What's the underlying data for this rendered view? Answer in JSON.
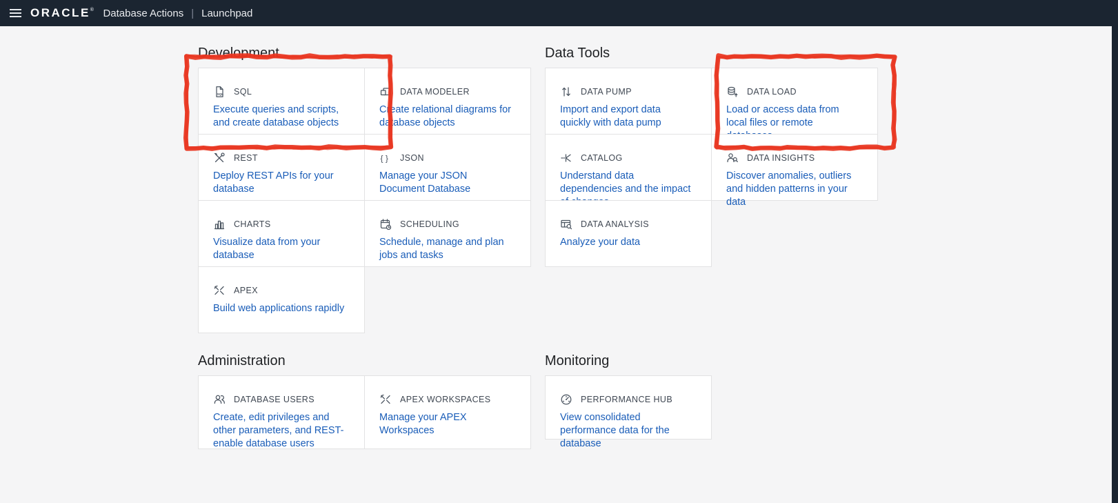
{
  "header": {
    "brand": "ORACLE",
    "brand_mark": "®",
    "app_title": "Database Actions",
    "separator": "|",
    "page_title": "Launchpad"
  },
  "colors": {
    "header_bg": "#1b2531",
    "page_bg": "#f5f5f6",
    "link_blue": "#1a5db8",
    "annotation_red": "#e8351f"
  },
  "sections": [
    {
      "title": "Development",
      "columns": [
        {
          "cards": [
            {
              "icon": "sql-file",
              "label": "SQL",
              "description": "Execute queries and scripts, and create database objects"
            },
            {
              "icon": "rest-tools",
              "label": "REST",
              "description": "Deploy REST APIs for your database"
            },
            {
              "icon": "bar-chart",
              "label": "CHARTS",
              "description": "Visualize data from your database"
            },
            {
              "icon": "apex",
              "label": "APEX",
              "description": "Build web applications rapidly"
            }
          ]
        },
        {
          "cards": [
            {
              "icon": "data-modeler",
              "label": "DATA MODELER",
              "description": "Create relational diagrams for database objects"
            },
            {
              "icon": "braces",
              "label": "JSON",
              "description": "Manage your JSON Document Database"
            },
            {
              "icon": "calendar-clock",
              "label": "SCHEDULING",
              "description": "Schedule, manage and plan jobs and tasks"
            }
          ]
        }
      ]
    },
    {
      "title": "Data Tools",
      "columns": [
        {
          "cards": [
            {
              "icon": "arrows-updown",
              "label": "DATA PUMP",
              "description": "Import and export data quickly with data pump"
            },
            {
              "icon": "fork-branch",
              "label": "CATALOG",
              "description": "Understand data dependencies and the impact of changes"
            },
            {
              "icon": "table-magnifier",
              "label": "DATA ANALYSIS",
              "description": "Analyze your data"
            }
          ]
        },
        {
          "cards": [
            {
              "icon": "database-up",
              "label": "DATA LOAD",
              "description": "Load or access data from local files or remote databases"
            },
            {
              "icon": "person-magnifier",
              "label": "DATA INSIGHTS",
              "description": "Discover anomalies, outliers and hidden patterns in your data"
            }
          ]
        }
      ]
    },
    {
      "title": "Administration",
      "columns": [
        {
          "cards": [
            {
              "icon": "users",
              "label": "DATABASE USERS",
              "description": "Create, edit privileges and other parameters, and REST-enable database users"
            }
          ]
        },
        {
          "cards": [
            {
              "icon": "apex",
              "label": "APEX WORKSPACES",
              "description": "Manage your APEX Workspaces"
            }
          ]
        }
      ]
    },
    {
      "title": "Monitoring",
      "columns": [
        {
          "cards": [
            {
              "icon": "gauge",
              "label": "PERFORMANCE HUB",
              "description": "View consolidated performance data for the database"
            }
          ]
        }
      ]
    }
  ],
  "annotations": [
    {
      "target": "SQL",
      "style": "hand-drawn-red-rectangle"
    },
    {
      "target": "DATA LOAD",
      "style": "hand-drawn-red-rectangle"
    }
  ]
}
